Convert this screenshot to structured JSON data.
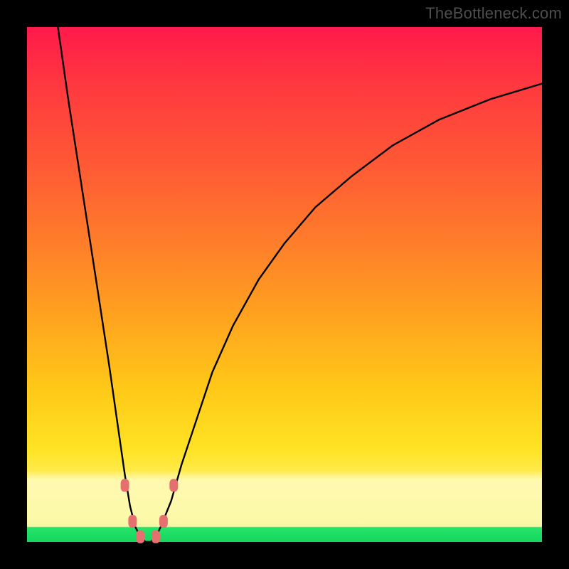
{
  "watermark": "TheBottleneck.com",
  "chart_data": {
    "type": "line",
    "title": "",
    "xlabel": "",
    "ylabel": "",
    "xlim": [
      0,
      100
    ],
    "ylim": [
      0,
      100
    ],
    "grid": false,
    "legend": false,
    "background_gradient_stops": [
      {
        "pos": 0,
        "color": "#ff1a4b"
      },
      {
        "pos": 28,
        "color": "#ff5c34"
      },
      {
        "pos": 56,
        "color": "#ffa21f"
      },
      {
        "pos": 82,
        "color": "#ffe324"
      },
      {
        "pos": 90,
        "color": "#fff06a"
      },
      {
        "pos": 97,
        "color": "#27e36a"
      },
      {
        "pos": 100,
        "color": "#14d65e"
      }
    ],
    "series": [
      {
        "name": "bottleneck-curve",
        "x": [
          6,
          8,
          10,
          12,
          14,
          16,
          18,
          19,
          20,
          21,
          22,
          23,
          24,
          25,
          26,
          28,
          30,
          33,
          36,
          40,
          45,
          50,
          56,
          63,
          71,
          80,
          90,
          100
        ],
        "y": [
          100,
          86,
          73,
          60,
          47,
          34,
          20,
          13,
          7,
          3,
          1,
          0,
          0,
          1,
          3,
          8,
          15,
          24,
          33,
          42,
          51,
          58,
          65,
          71,
          77,
          82,
          86,
          89
        ]
      }
    ],
    "markers": [
      {
        "name": "marker-left-upper",
        "x": 19.0,
        "y": 11,
        "color": "#e6706f"
      },
      {
        "name": "marker-left-lower",
        "x": 20.5,
        "y": 4,
        "color": "#e6706f"
      },
      {
        "name": "marker-min-left",
        "x": 22.0,
        "y": 1,
        "color": "#e6706f"
      },
      {
        "name": "marker-min-right",
        "x": 25.0,
        "y": 1,
        "color": "#e6706f"
      },
      {
        "name": "marker-right-lower",
        "x": 26.5,
        "y": 4,
        "color": "#e6706f"
      },
      {
        "name": "marker-right-upper",
        "x": 28.5,
        "y": 11,
        "color": "#e6706f"
      }
    ]
  }
}
